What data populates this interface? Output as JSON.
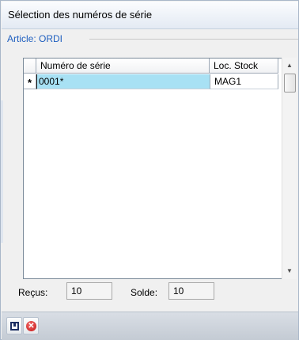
{
  "window": {
    "title": "Sélection des numéros de série"
  },
  "article": {
    "label": "Article: ORDI"
  },
  "grid": {
    "columns": [
      "Numéro de série",
      "Loc. Stock"
    ],
    "rows": [
      {
        "marker": "*",
        "serial": "0001*",
        "location": "MAG1"
      }
    ]
  },
  "footer": {
    "recus_label": "Reçus:",
    "recus_value": "10",
    "solde_label": "Solde:",
    "solde_value": "10"
  },
  "toolbar": {
    "icons": [
      "save-icon",
      "cancel-icon"
    ]
  },
  "colors": {
    "selected_cell": "#a8e1f4",
    "article_label": "#1f5fbf"
  }
}
